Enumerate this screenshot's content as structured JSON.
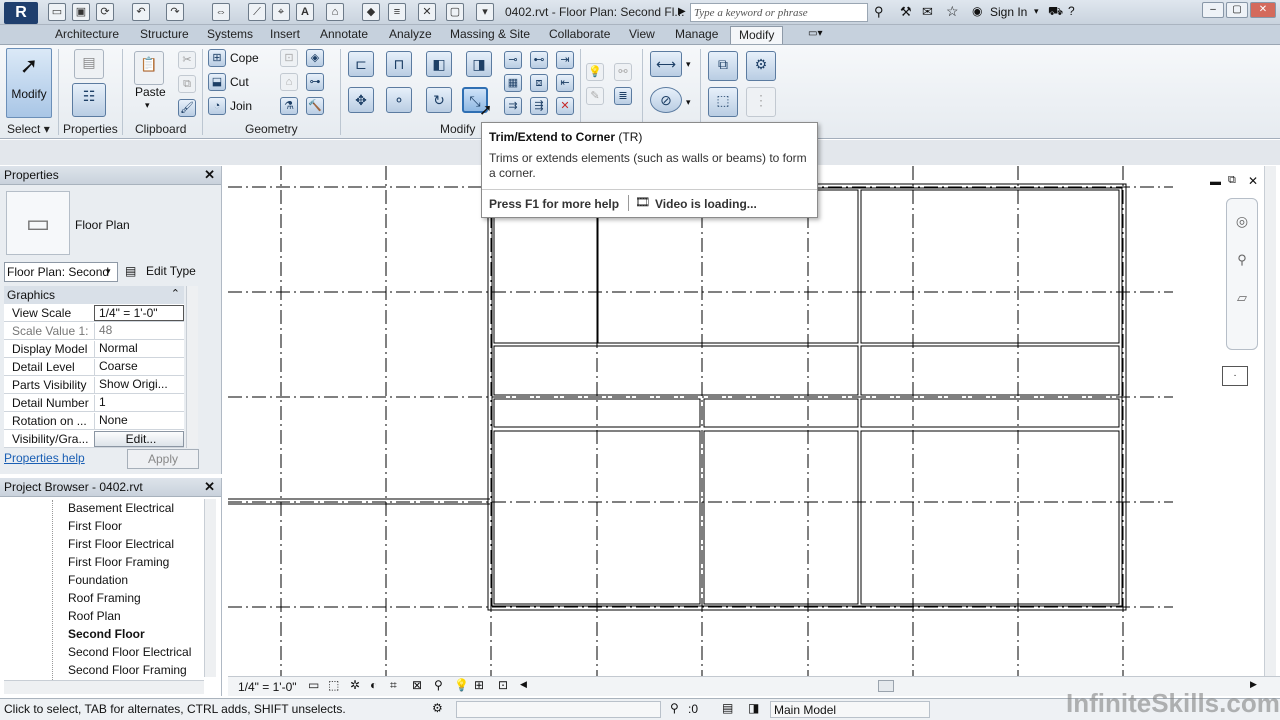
{
  "app": {
    "doc_title": "0402.rvt - Floor Plan: Second Fl...",
    "search_placeholder": "Type a keyword or phrase",
    "sign_in": "Sign In"
  },
  "tabs": [
    "Architecture",
    "Structure",
    "Systems",
    "Insert",
    "Annotate",
    "Analyze",
    "Massing & Site",
    "Collaborate",
    "View",
    "Manage",
    "Modify"
  ],
  "active_tab": "Modify",
  "ribbon": {
    "modify_label": "Modify",
    "select_label": "Select",
    "panels": {
      "properties": "Properties",
      "clipboard": "Clipboard",
      "geometry": "Geometry",
      "modify": "Modify"
    },
    "paste": "Paste",
    "cope": "Cope",
    "cut": "Cut",
    "join": "Join"
  },
  "tooltip": {
    "title": "Trim/Extend to Corner",
    "shortcut": "(TR)",
    "description": "Trims or extends elements (such as walls or beams) to form a corner.",
    "help": "Press F1 for more help",
    "video": "Video is loading..."
  },
  "properties_panel": {
    "header": "Properties",
    "type_name": "Floor Plan",
    "instance_selector": "Floor Plan: Second",
    "edit_type": "Edit Type",
    "section": "Graphics",
    "rows": [
      {
        "key": "View Scale",
        "value": "1/4\" = 1'-0\""
      },
      {
        "key": "Scale Value    1:",
        "value": "48"
      },
      {
        "key": "Display Model",
        "value": "Normal"
      },
      {
        "key": "Detail Level",
        "value": "Coarse"
      },
      {
        "key": "Parts Visibility",
        "value": "Show Origi..."
      },
      {
        "key": "Detail Number",
        "value": "1"
      },
      {
        "key": "Rotation on ...",
        "value": "None"
      },
      {
        "key": "Visibility/Gra...",
        "value": "Edit..."
      }
    ],
    "help_link": "Properties help",
    "apply": "Apply"
  },
  "project_browser": {
    "header": "Project Browser - 0402.rvt",
    "items": [
      "Basement Electrical",
      "First Floor",
      "First Floor Electrical",
      "First Floor Framing",
      "Foundation",
      "Roof Framing",
      "Roof Plan",
      "Second Floor",
      "Second Floor Electrical",
      "Second Floor Framing"
    ],
    "selected": "Second Floor"
  },
  "view_bar": {
    "scale": "1/4\" = 1'-0\""
  },
  "status": {
    "message": "Click to select, TAB for alternates, CTRL adds, SHIFT unselects.",
    "count": ":0",
    "model": "Main Model"
  },
  "watermark": "InfiniteSkills.com"
}
